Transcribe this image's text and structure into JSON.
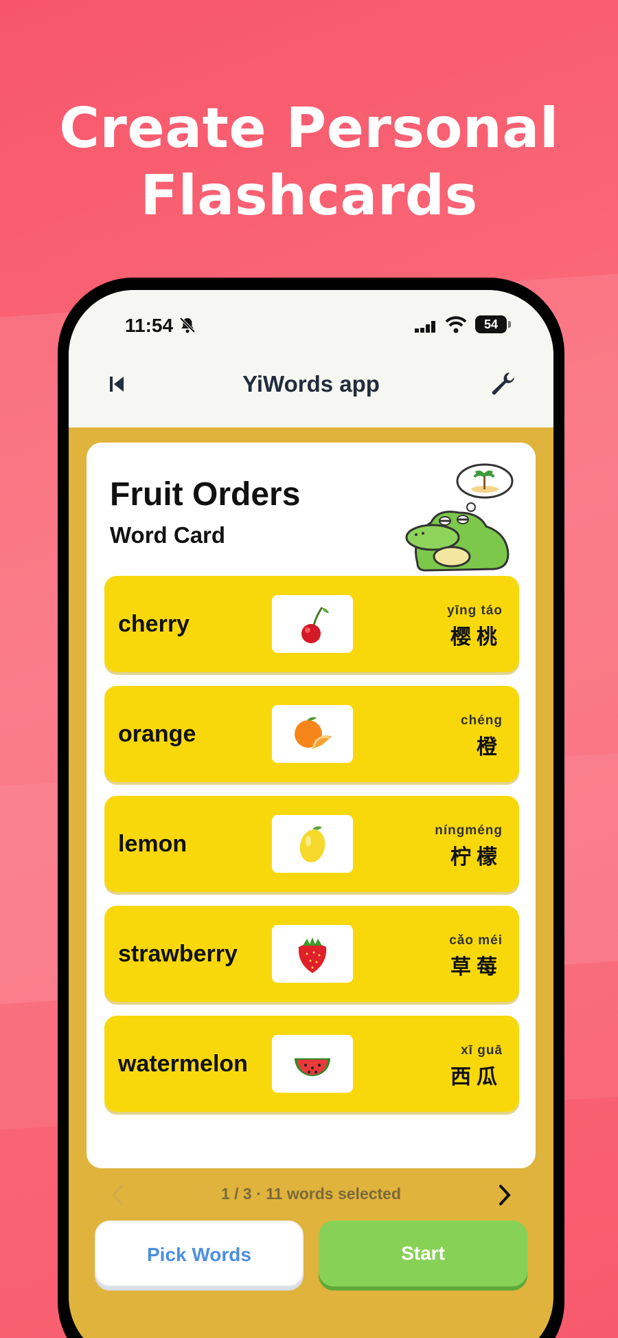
{
  "headline": {
    "line1": "Create Personal",
    "line2": "Flashcards"
  },
  "status_bar": {
    "time": "11:54",
    "battery": "54",
    "icons": [
      "bell-muted-icon",
      "cellular-signal-icon",
      "wifi-icon",
      "battery-icon"
    ]
  },
  "nav": {
    "title": "YiWords app",
    "back_icon": "skip-back-icon",
    "settings_icon": "wrench-icon"
  },
  "card": {
    "title": "Fruit Orders",
    "subtitle": "Word Card",
    "mascot": "crocodile-dreaming-mascot"
  },
  "words": [
    {
      "english": "cherry",
      "pinyin": "yīng táo",
      "hanzi": "樱桃",
      "picture": "cherry-icon"
    },
    {
      "english": "orange",
      "pinyin": "chéng",
      "hanzi": "橙",
      "picture": "orange-icon"
    },
    {
      "english": "lemon",
      "pinyin": "níngméng",
      "hanzi": "柠檬",
      "picture": "lemon-icon"
    },
    {
      "english": "strawberry",
      "pinyin": "cǎo méi",
      "hanzi": "草莓",
      "picture": "strawberry-icon"
    },
    {
      "english": "watermelon",
      "pinyin": "xī guā",
      "hanzi": "西瓜",
      "picture": "watermelon-icon"
    }
  ],
  "pager": {
    "text": "1 / 3 · 11 words selected",
    "prev_icon": "chevron-left-icon",
    "next_icon": "chevron-right-icon"
  },
  "buttons": {
    "pick_words": "Pick Words",
    "start": "Start"
  },
  "colors": {
    "background": "#f7566a",
    "app_background": "#e0b33d",
    "word_row": "#f8d80a",
    "start_button": "#88d157",
    "pick_button_text": "#4b8ee0"
  }
}
